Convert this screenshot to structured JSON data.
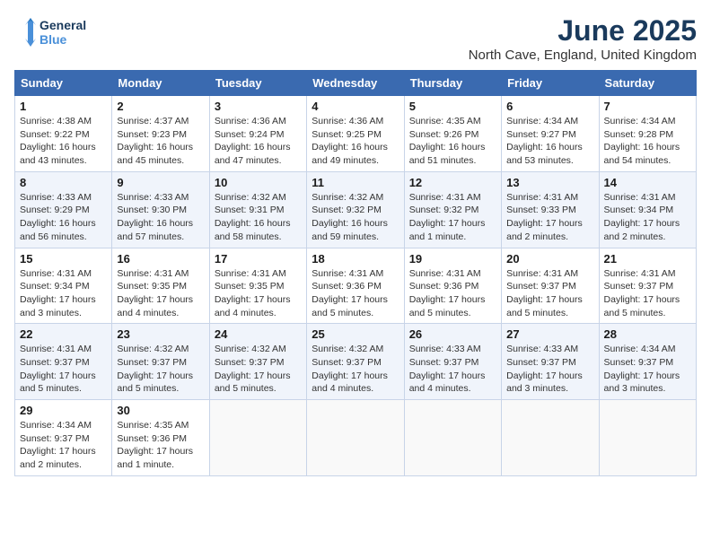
{
  "logo": {
    "line1": "General",
    "line2": "Blue"
  },
  "title": "June 2025",
  "location": "North Cave, England, United Kingdom",
  "days_of_week": [
    "Sunday",
    "Monday",
    "Tuesday",
    "Wednesday",
    "Thursday",
    "Friday",
    "Saturday"
  ],
  "weeks": [
    [
      {
        "day": "1",
        "sunrise": "4:38 AM",
        "sunset": "9:22 PM",
        "daylight": "16 hours and 43 minutes."
      },
      {
        "day": "2",
        "sunrise": "4:37 AM",
        "sunset": "9:23 PM",
        "daylight": "16 hours and 45 minutes."
      },
      {
        "day": "3",
        "sunrise": "4:36 AM",
        "sunset": "9:24 PM",
        "daylight": "16 hours and 47 minutes."
      },
      {
        "day": "4",
        "sunrise": "4:36 AM",
        "sunset": "9:25 PM",
        "daylight": "16 hours and 49 minutes."
      },
      {
        "day": "5",
        "sunrise": "4:35 AM",
        "sunset": "9:26 PM",
        "daylight": "16 hours and 51 minutes."
      },
      {
        "day": "6",
        "sunrise": "4:34 AM",
        "sunset": "9:27 PM",
        "daylight": "16 hours and 53 minutes."
      },
      {
        "day": "7",
        "sunrise": "4:34 AM",
        "sunset": "9:28 PM",
        "daylight": "16 hours and 54 minutes."
      }
    ],
    [
      {
        "day": "8",
        "sunrise": "4:33 AM",
        "sunset": "9:29 PM",
        "daylight": "16 hours and 56 minutes."
      },
      {
        "day": "9",
        "sunrise": "4:33 AM",
        "sunset": "9:30 PM",
        "daylight": "16 hours and 57 minutes."
      },
      {
        "day": "10",
        "sunrise": "4:32 AM",
        "sunset": "9:31 PM",
        "daylight": "16 hours and 58 minutes."
      },
      {
        "day": "11",
        "sunrise": "4:32 AM",
        "sunset": "9:32 PM",
        "daylight": "16 hours and 59 minutes."
      },
      {
        "day": "12",
        "sunrise": "4:31 AM",
        "sunset": "9:32 PM",
        "daylight": "17 hours and 1 minute."
      },
      {
        "day": "13",
        "sunrise": "4:31 AM",
        "sunset": "9:33 PM",
        "daylight": "17 hours and 2 minutes."
      },
      {
        "day": "14",
        "sunrise": "4:31 AM",
        "sunset": "9:34 PM",
        "daylight": "17 hours and 2 minutes."
      }
    ],
    [
      {
        "day": "15",
        "sunrise": "4:31 AM",
        "sunset": "9:34 PM",
        "daylight": "17 hours and 3 minutes."
      },
      {
        "day": "16",
        "sunrise": "4:31 AM",
        "sunset": "9:35 PM",
        "daylight": "17 hours and 4 minutes."
      },
      {
        "day": "17",
        "sunrise": "4:31 AM",
        "sunset": "9:35 PM",
        "daylight": "17 hours and 4 minutes."
      },
      {
        "day": "18",
        "sunrise": "4:31 AM",
        "sunset": "9:36 PM",
        "daylight": "17 hours and 5 minutes."
      },
      {
        "day": "19",
        "sunrise": "4:31 AM",
        "sunset": "9:36 PM",
        "daylight": "17 hours and 5 minutes."
      },
      {
        "day": "20",
        "sunrise": "4:31 AM",
        "sunset": "9:37 PM",
        "daylight": "17 hours and 5 minutes."
      },
      {
        "day": "21",
        "sunrise": "4:31 AM",
        "sunset": "9:37 PM",
        "daylight": "17 hours and 5 minutes."
      }
    ],
    [
      {
        "day": "22",
        "sunrise": "4:31 AM",
        "sunset": "9:37 PM",
        "daylight": "17 hours and 5 minutes."
      },
      {
        "day": "23",
        "sunrise": "4:32 AM",
        "sunset": "9:37 PM",
        "daylight": "17 hours and 5 minutes."
      },
      {
        "day": "24",
        "sunrise": "4:32 AM",
        "sunset": "9:37 PM",
        "daylight": "17 hours and 5 minutes."
      },
      {
        "day": "25",
        "sunrise": "4:32 AM",
        "sunset": "9:37 PM",
        "daylight": "17 hours and 4 minutes."
      },
      {
        "day": "26",
        "sunrise": "4:33 AM",
        "sunset": "9:37 PM",
        "daylight": "17 hours and 4 minutes."
      },
      {
        "day": "27",
        "sunrise": "4:33 AM",
        "sunset": "9:37 PM",
        "daylight": "17 hours and 3 minutes."
      },
      {
        "day": "28",
        "sunrise": "4:34 AM",
        "sunset": "9:37 PM",
        "daylight": "17 hours and 3 minutes."
      }
    ],
    [
      {
        "day": "29",
        "sunrise": "4:34 AM",
        "sunset": "9:37 PM",
        "daylight": "17 hours and 2 minutes."
      },
      {
        "day": "30",
        "sunrise": "4:35 AM",
        "sunset": "9:36 PM",
        "daylight": "17 hours and 1 minute."
      },
      null,
      null,
      null,
      null,
      null
    ]
  ],
  "labels": {
    "sunrise": "Sunrise:",
    "sunset": "Sunset:",
    "daylight": "Daylight:"
  }
}
